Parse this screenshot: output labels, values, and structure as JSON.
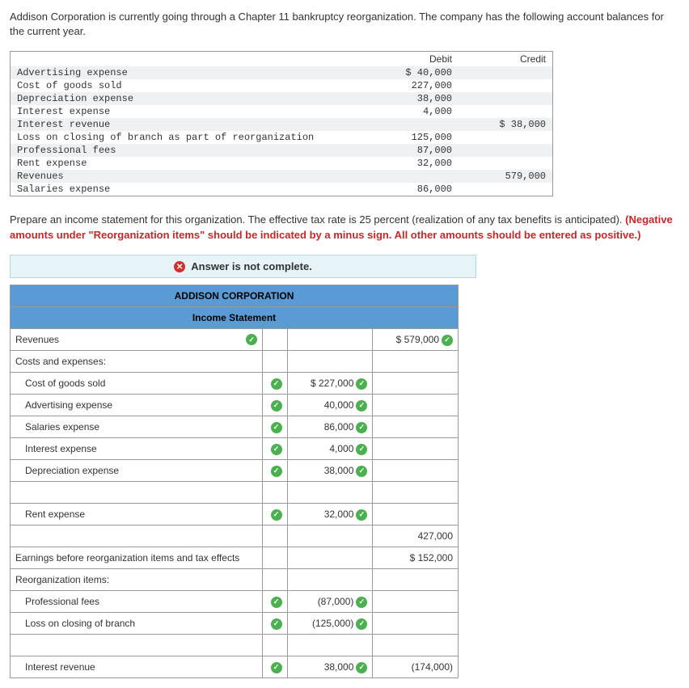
{
  "intro": "Addison Corporation is currently going through a Chapter 11 bankruptcy reorganization. The company has the following account balances for the current year.",
  "tb": {
    "head_debit": "Debit",
    "head_credit": "Credit",
    "rows": [
      {
        "label": "Advertising expense",
        "debit": "$  40,000",
        "credit": ""
      },
      {
        "label": "Cost of goods sold",
        "debit": "227,000",
        "credit": ""
      },
      {
        "label": "Depreciation expense",
        "debit": "38,000",
        "credit": ""
      },
      {
        "label": "Interest expense",
        "debit": "4,000",
        "credit": ""
      },
      {
        "label": "Interest revenue",
        "debit": "",
        "credit": "$ 38,000"
      },
      {
        "label": "Loss on closing of branch as part of reorganization",
        "debit": "125,000",
        "credit": ""
      },
      {
        "label": "Professional fees",
        "debit": "87,000",
        "credit": ""
      },
      {
        "label": "Rent expense",
        "debit": "32,000",
        "credit": ""
      },
      {
        "label": "Revenues",
        "debit": "",
        "credit": "579,000"
      },
      {
        "label": "Salaries expense",
        "debit": "86,000",
        "credit": ""
      }
    ]
  },
  "instruct": {
    "p1": "Prepare an income statement for this organization. The effective tax rate is 25 percent (realization of any tax benefits is anticipated).",
    "p2": "(Negative amounts under \"Reorganization items\" should be indicated by a minus sign. All other amounts should be entered as positive.)"
  },
  "banner": "Answer is not complete.",
  "inc": {
    "corp": "ADDISON CORPORATION",
    "title": "Income Statement",
    "revenues": "Revenues",
    "rev_val": "$ 579,000",
    "costs": "Costs and expenses:",
    "cogs": "Cost of goods sold",
    "cogs_v": "$ 227,000",
    "adv": "Advertising expense",
    "adv_v": "40,000",
    "sal": "Salaries expense",
    "sal_v": "86,000",
    "int": "Interest expense",
    "int_v": "4,000",
    "dep": "Depreciation expense",
    "dep_v": "38,000",
    "rent": "Rent expense",
    "rent_v": "32,000",
    "subtotal": "427,000",
    "ebit": "Earnings before reorganization items and tax effects",
    "ebit_v": "$ 152,000",
    "reorg": "Reorganization items:",
    "prof": "Professional fees",
    "prof_v": "(87,000)",
    "loss": "Loss on closing of branch",
    "loss_v": "(125,000)",
    "intrev": "Interest revenue",
    "intrev_v": "38,000",
    "reorg_total": "(174,000)"
  }
}
